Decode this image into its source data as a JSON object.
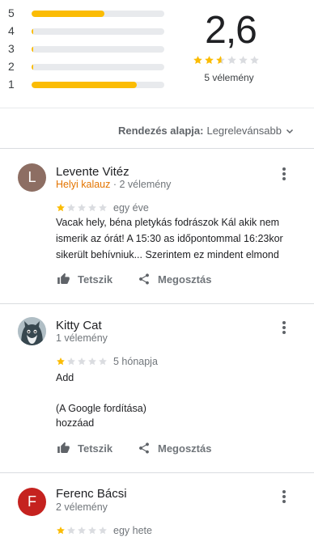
{
  "summary": {
    "distribution": [
      {
        "stars": "5",
        "fraction": 0.55
      },
      {
        "stars": "4",
        "fraction": 0.01
      },
      {
        "stars": "3",
        "fraction": 0.01
      },
      {
        "stars": "2",
        "fraction": 0.01
      },
      {
        "stars": "1",
        "fraction": 0.79
      }
    ],
    "average": "2,6",
    "average_stars": 2.6,
    "review_count": "5 vélemény"
  },
  "sort": {
    "label": "Rendezés alapja:",
    "value": "Legrelevánsabb"
  },
  "actions": {
    "like": "Tetszik",
    "share": "Megosztás"
  },
  "colors": {
    "star_full": "#fbbc04",
    "star_empty": "#dadce0",
    "bar_fill": "#fbbc04",
    "local_guide": "#e37400"
  },
  "reviews": [
    {
      "avatar_letter": "L",
      "avatar_color": "#8d6e63",
      "name": "Levente Vitéz",
      "guide": "Helyi kalauz",
      "meta": "· 2 vélemény",
      "stars": 1,
      "time": "egy éve",
      "lines": [
        "Vacak hely, béna pletykás fodrászok Kál akik nem",
        "ismerik az órát! A 15:30 as időpontommal 16:23kor",
        "sikerült behívniuk... Szerintem ez mindent elmond"
      ]
    },
    {
      "avatar_letter": "",
      "avatar_icon": "cat-photo",
      "name": "Kitty Cat",
      "meta": "1 vélemény",
      "stars": 1,
      "time": "5 hónapja",
      "original": "Add",
      "translation_label": "(A Google fordítása)",
      "translation": "hozzáad"
    },
    {
      "avatar_letter": "F",
      "avatar_color": "#c5221f",
      "name": "Ferenc Bácsi",
      "meta": "2 vélemény",
      "stars": 1,
      "time": "egy hete"
    }
  ]
}
